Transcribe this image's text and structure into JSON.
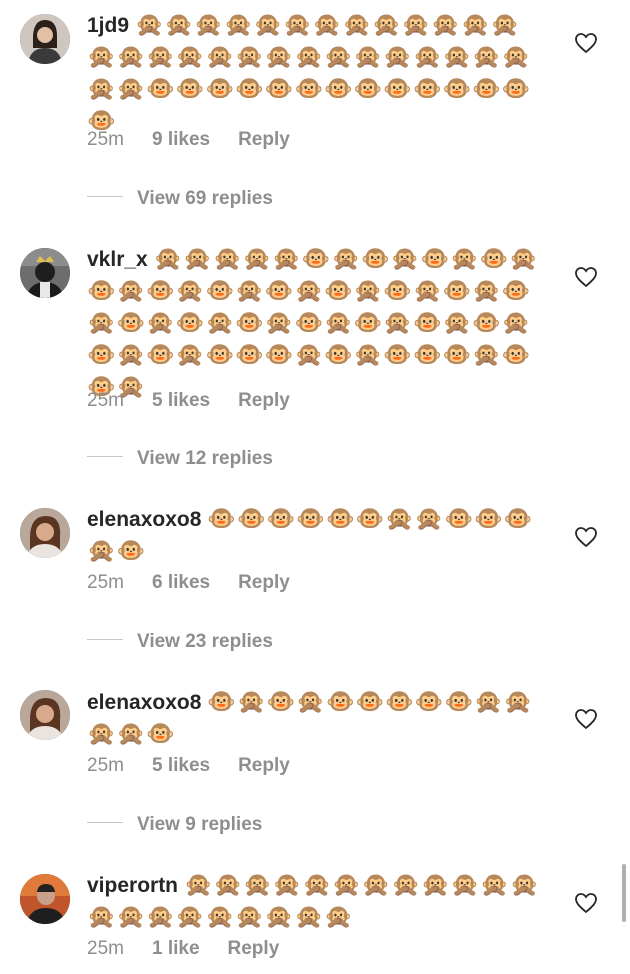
{
  "comments": [
    {
      "username": "1jd9",
      "text": "🙊🙊🙊🙊🙊🙊🙊🙊🙊🙊🙊🙊🙊🙊🙊🙊🙊🙊🙊🙊🙊🙊🙊🙊🙊🙊🙊🙊🙊🙊🐵🐵🐵🐵🐵🐵🐵🐵🐵🐵🐵🐵🐵🐵",
      "time": "25m",
      "likes": "9 likes",
      "reply": "Reply",
      "view_replies": "View 69 replies",
      "avatar_color": "#3b2f2f"
    },
    {
      "username": "vklr_x",
      "text": "🙊🙊🙊🙊🙊🐵🙊🐵🙊🐵🙊🐵🙊🐵🙊🐵🙊🐵🙊🐵🙊🐵🙊🐵🙊🐵🙊🐵🙊🐵🙊🐵🙊🐵🙊🐵🙊🐵🙊🐵🙊🐵🙊🐵🙊🐵🙊🐵🐵🐵🙊🐵🙊🐵🐵🐵🙊🐵🐵🙊",
      "time": "25m",
      "likes": "5 likes",
      "reply": "Reply",
      "view_replies": "View 12 replies",
      "avatar_color": "#4a4a4a"
    },
    {
      "username": "elenaxoxo8",
      "text": "🐵🐵🐵🐵🐵🐵🙊🙊🐵🐵🐵🙊🐵",
      "time": "25m",
      "likes": "6 likes",
      "reply": "Reply",
      "view_replies": "View 23 replies",
      "avatar_color": "#8a5a44"
    },
    {
      "username": "elenaxoxo8",
      "text": "🐵🙊🐵🙊🐵🐵🐵🐵🐵🙊🙊🙊🙊🐵",
      "time": "25m",
      "likes": "5 likes",
      "reply": "Reply",
      "view_replies": "View 9 replies",
      "avatar_color": "#8a5a44"
    },
    {
      "username": "viperortn",
      "text": "🙊🙊🙊🙊🙊🙊🙊🙊🙊🙊🙊🙊🙊🙊🙊🙊🙊🙊🙊🙊🙊",
      "time": "25m",
      "likes": "1 like",
      "reply": "Reply",
      "avatar_color": "#2e2a28"
    }
  ],
  "icons": {
    "like": "heart-outline-icon"
  }
}
